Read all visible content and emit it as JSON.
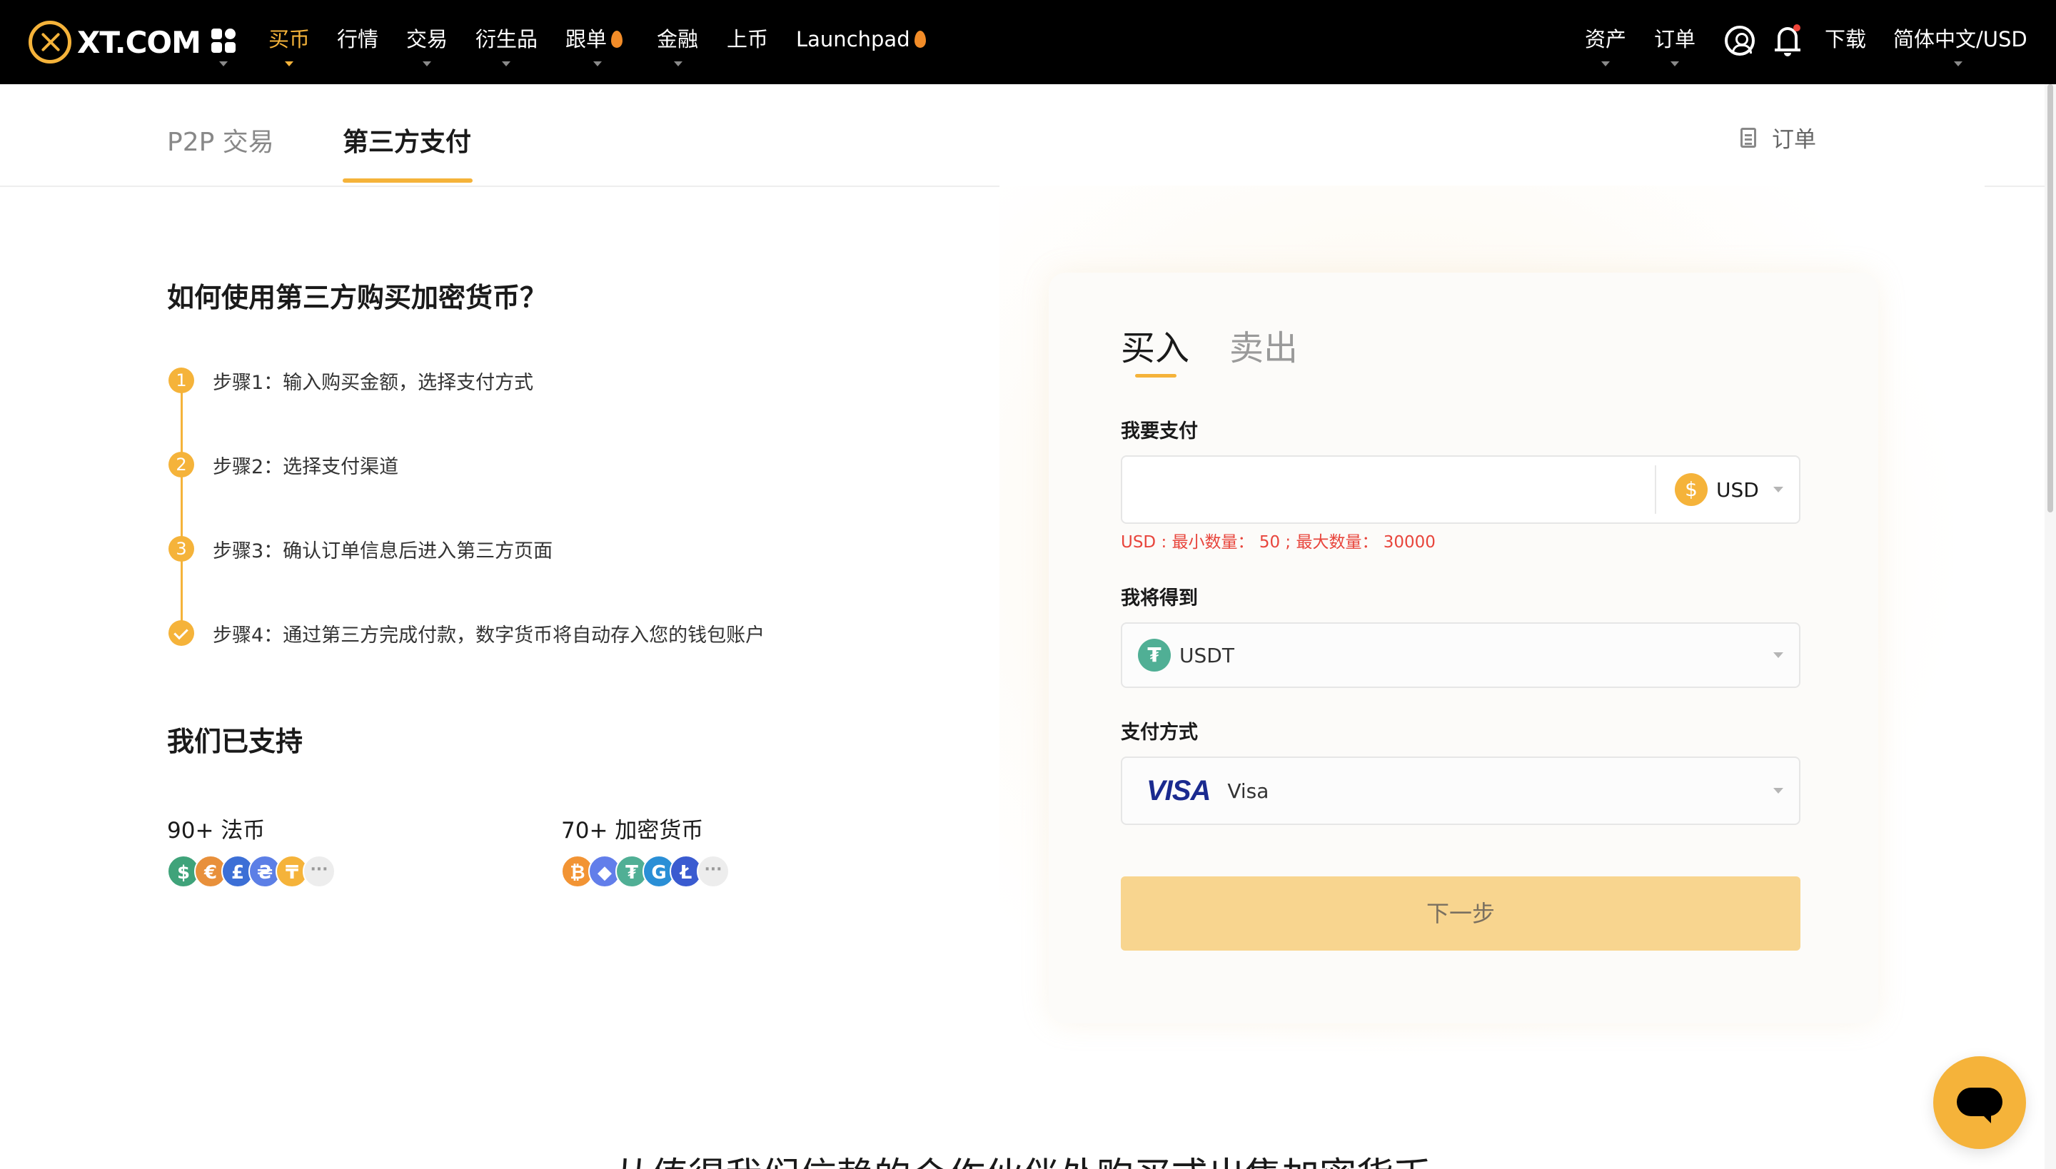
{
  "topnav": {
    "logo_text": "XT.COM",
    "items": [
      {
        "label": "买币",
        "active": true
      },
      {
        "label": "行情"
      },
      {
        "label": "交易"
      },
      {
        "label": "衍生品"
      },
      {
        "label": "跟单"
      },
      {
        "label": "金融"
      },
      {
        "label": "上币"
      },
      {
        "label": "Launchpad"
      }
    ],
    "right": {
      "assets": "资产",
      "orders": "订单",
      "download": "下载",
      "language": "简体中文/USD"
    },
    "icons": [
      "apps-grid-icon",
      "user-icon",
      "bell-icon",
      "flame-icon"
    ]
  },
  "subnav": {
    "tabs": [
      "P2P 交易",
      "第三方支付"
    ],
    "active_tab": "第三方支付",
    "orders_label": "订单"
  },
  "guide": {
    "title": "如何使用第三方购买加密货币？",
    "steps": [
      {
        "num": "1",
        "text": "步骤1：输入购买金额，选择支付方式"
      },
      {
        "num": "2",
        "text": "步骤2：选择支付渠道"
      },
      {
        "num": "3",
        "text": "步骤3：确认订单信息后进入第三方页面"
      },
      {
        "num": "",
        "text": "步骤4：通过第三方完成付款，数字货币将自动存入您的钱包账户"
      }
    ]
  },
  "supported": {
    "title": "我们已支持",
    "fiat_label": "90+ 法币",
    "crypto_label": "70+ 加密货币",
    "fiat_coins": [
      {
        "symbol": "$",
        "color": "#3fa37a"
      },
      {
        "symbol": "€",
        "color": "#e8903b"
      },
      {
        "symbol": "£",
        "color": "#3c6fd6"
      },
      {
        "symbol": "₴",
        "color": "#5c7fe6"
      },
      {
        "symbol": "₸",
        "color": "#f5b33a"
      },
      {
        "symbol": "···",
        "color": "#ededed"
      }
    ],
    "crypto_coins": [
      {
        "symbol": "₿",
        "color": "#f29434"
      },
      {
        "symbol": "◆",
        "color": "#627eea"
      },
      {
        "symbol": "₮",
        "color": "#50af95"
      },
      {
        "symbol": "G",
        "color": "#2a8fd6"
      },
      {
        "symbol": "Ł",
        "color": "#3a5bd0"
      },
      {
        "symbol": "···",
        "color": "#ededed"
      }
    ]
  },
  "trade": {
    "tabs": {
      "buy": "买入",
      "sell": "卖出"
    },
    "active_tab": "买入",
    "pay_label": "我要支付",
    "amount_value": "",
    "pay_currency": "USD",
    "limits_text": "USD : 最小数量： 50 ; 最大数量： 30000",
    "receive_label": "我将得到",
    "receive_currency": "USDT",
    "method_label": "支付方式",
    "method_logo": "VISA",
    "method_name": "Visa",
    "next_button": "下一步"
  },
  "bottom_heading": "从值得我们信赖的合作伙伴处购买或出售加密货币",
  "colors": {
    "accent": "#f5b33a",
    "nav_bg": "#000000",
    "error": "#e8453c",
    "button_disabled": "#f8d58f"
  }
}
